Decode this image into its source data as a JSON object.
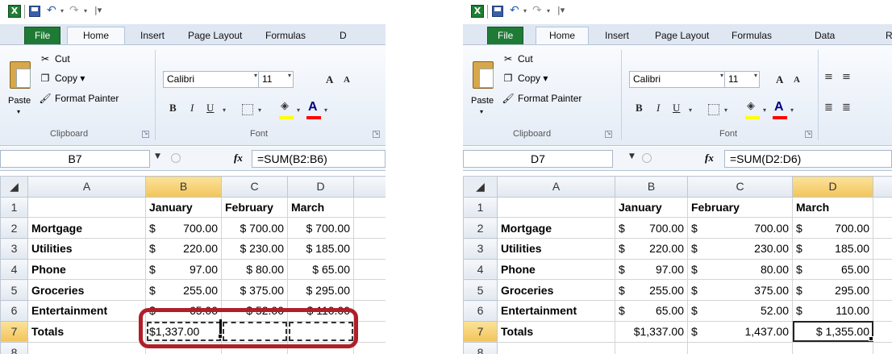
{
  "left": {
    "tabs": [
      "File",
      "Home",
      "Insert",
      "Page Layout",
      "Formulas",
      "D"
    ],
    "clipboard": {
      "paste": "Paste",
      "cut": "Cut",
      "copy": "Copy ▾",
      "format_painter": "Format Painter",
      "group": "Clipboard"
    },
    "font": {
      "name": "Calibri",
      "size": "11",
      "group": "Font"
    },
    "name_box": "B7",
    "formula": "=SUM(B2:B6)",
    "columns": [
      "A",
      "B",
      "C",
      "D"
    ],
    "rows": [
      {
        "n": "1",
        "a": "",
        "b": "January",
        "c": "February",
        "d": "March"
      },
      {
        "n": "2",
        "a": "Mortgage",
        "b": [
          "$",
          "700.00"
        ],
        "c": "$ 700.00",
        "d": "$ 700.00"
      },
      {
        "n": "3",
        "a": "Utilities",
        "b": [
          "$",
          "220.00"
        ],
        "c": "$ 230.00",
        "d": "$ 185.00"
      },
      {
        "n": "4",
        "a": "Phone",
        "b": [
          "$",
          "97.00"
        ],
        "c": "$ 80.00",
        "d": "$ 65.00"
      },
      {
        "n": "5",
        "a": "Groceries",
        "b": [
          "$",
          "255.00"
        ],
        "c": "$ 375.00",
        "d": "$ 295.00"
      },
      {
        "n": "6",
        "a": "Entertainment",
        "b": [
          "$",
          "65.00"
        ],
        "c": "$ 52.00",
        "d": "$ 110.00"
      },
      {
        "n": "7",
        "a": "Totals",
        "b": "$1,337.00",
        "c": "",
        "d": ""
      },
      {
        "n": "8",
        "a": "",
        "b": "",
        "c": "",
        "d": ""
      }
    ]
  },
  "right": {
    "tabs": [
      "File",
      "Home",
      "Insert",
      "Page Layout",
      "Formulas",
      "Data",
      "R"
    ],
    "clipboard": {
      "paste": "Paste",
      "cut": "Cut",
      "copy": "Copy ▾",
      "format_painter": "Format Painter",
      "group": "Clipboard"
    },
    "font": {
      "name": "Calibri",
      "size": "11",
      "group": "Font"
    },
    "name_box": "D7",
    "formula": "=SUM(D2:D6)",
    "columns": [
      "A",
      "B",
      "C",
      "D"
    ],
    "rows": [
      {
        "n": "1",
        "a": "",
        "b": "January",
        "c": "February",
        "d": "March"
      },
      {
        "n": "2",
        "a": "Mortgage",
        "b": [
          "$",
          "700.00"
        ],
        "c": [
          "$",
          "700.00"
        ],
        "d": [
          "$",
          "700.00"
        ]
      },
      {
        "n": "3",
        "a": "Utilities",
        "b": [
          "$",
          "220.00"
        ],
        "c": [
          "$",
          "230.00"
        ],
        "d": [
          "$",
          "185.00"
        ]
      },
      {
        "n": "4",
        "a": "Phone",
        "b": [
          "$",
          "97.00"
        ],
        "c": [
          "$",
          "80.00"
        ],
        "d": [
          "$",
          "65.00"
        ]
      },
      {
        "n": "5",
        "a": "Groceries",
        "b": [
          "$",
          "255.00"
        ],
        "c": [
          "$",
          "375.00"
        ],
        "d": [
          "$",
          "295.00"
        ]
      },
      {
        "n": "6",
        "a": "Entertainment",
        "b": [
          "$",
          "65.00"
        ],
        "c": [
          "$",
          "52.00"
        ],
        "d": [
          "$",
          "110.00"
        ]
      },
      {
        "n": "7",
        "a": "Totals",
        "b": "$1,337.00",
        "c": [
          "$",
          "1,437.00"
        ],
        "d": "$ 1,355.00"
      },
      {
        "n": "8",
        "a": "",
        "b": "",
        "c": "",
        "d": ""
      }
    ]
  },
  "icons": {
    "excel": "X",
    "undo": "↶",
    "redo": "↷",
    "grow_font": "A",
    "shrink_font": "A",
    "fx": "fx"
  },
  "colors": {
    "file_tab": "#1f7a35",
    "highlight_ring": "#b01e28",
    "selected_header": "#f2c45c"
  }
}
